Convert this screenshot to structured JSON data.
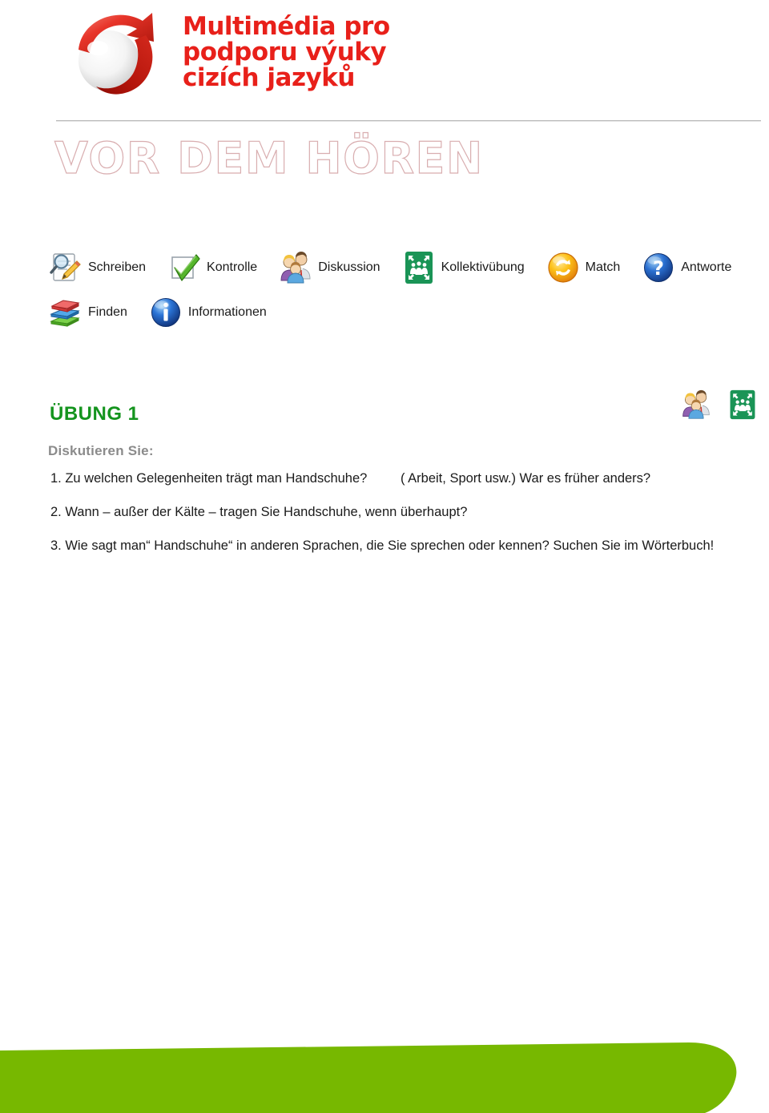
{
  "document": {
    "logo": {
      "title": "Multimédia pro\npodporu výuky\ncizích jazyků",
      "mark_name": "red-swirl-sphere-logo",
      "brand_color": "#e8201a"
    },
    "section_heading": "VOR DEM HÖREN",
    "heading_outline_color": "#d9aeb0"
  },
  "legend": {
    "rows": [
      [
        {
          "icon": "document-magnifier-pencil-icon",
          "label": "Schreiben"
        },
        {
          "icon": "green-checkmark-box-icon",
          "label": "Kontrolle"
        },
        {
          "icon": "three-people-icon",
          "label": "Diskussion"
        },
        {
          "icon": "assembly-point-green-icon",
          "label": "Kollektivübung"
        },
        {
          "icon": "orange-refresh-circle-icon",
          "label": "Match"
        },
        {
          "icon": "blue-question-mark-circle-icon",
          "label": "Antworte"
        }
      ],
      [
        {
          "icon": "stack-of-books-icon",
          "label": "Finden"
        },
        {
          "icon": "blue-info-circle-icon",
          "label": "Informationen"
        }
      ]
    ]
  },
  "exercise": {
    "title": "ÜBUNG  1",
    "title_color": "#14941e",
    "subtitle": "Diskutieren Sie:",
    "header_icons": [
      {
        "icon": "three-people-icon",
        "name": "Diskussion"
      },
      {
        "icon": "assembly-point-green-icon",
        "name": "Kollektivübung"
      }
    ],
    "questions": [
      {
        "main": "1. Zu welchen Gelegenheiten trägt man Handschuhe?",
        "aside": "( Arbeit, Sport usw.)  War es früher anders?"
      },
      {
        "main": "2. Wann – außer der Kälte – tragen Sie Handschuhe, wenn überhaupt?",
        "aside": ""
      },
      {
        "main": "3. Wie sagt man“ Handschuhe“ in anderen Sprachen, die Sie sprechen oder kennen? Suchen Sie im Wörterbuch!",
        "aside": ""
      }
    ]
  },
  "footer": {
    "banner_color": "#77b800"
  }
}
